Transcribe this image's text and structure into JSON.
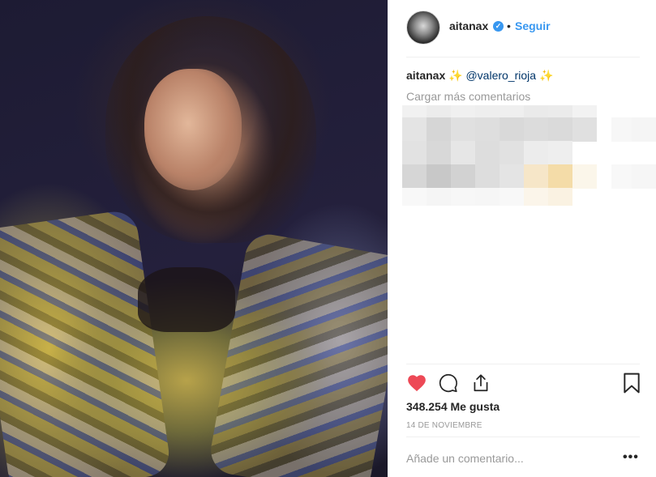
{
  "post": {
    "image_alt": "aitanax photo",
    "username": "aitanax",
    "verified": true,
    "separator": "•",
    "follow_label": "Seguir",
    "caption": {
      "username": "aitanax",
      "sparkle": "✨",
      "mention": "@valero_rioja"
    },
    "load_more_label": "Cargar más comentarios",
    "likes_text": "348.254 Me gusta",
    "date_text": "14 DE NOVIEMBRE",
    "comment_placeholder": "Añade un comentario...",
    "more_options_label": "•••"
  },
  "icons": {
    "avatar": "avatar",
    "verified": "verified-badge-icon",
    "heart": "heart-icon",
    "comment": "comment-icon",
    "share": "share-icon",
    "save": "bookmark-icon",
    "more": "more-options-icon"
  },
  "colors": {
    "accent_blue": "#3897f0",
    "like_red": "#ed4956",
    "muted_text": "#999999",
    "text": "#262626",
    "divider": "#efefef"
  }
}
